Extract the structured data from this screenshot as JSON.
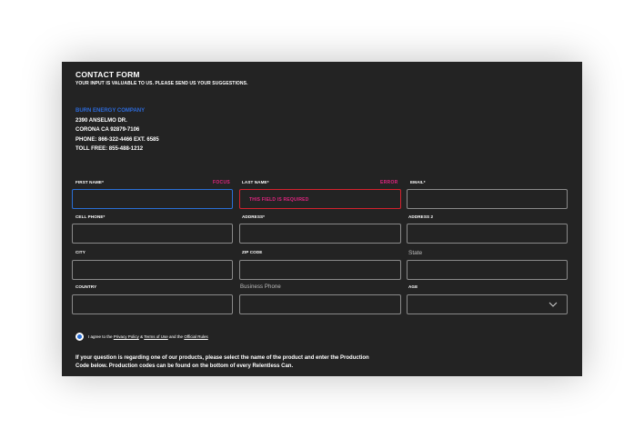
{
  "header": {
    "title": "CONTACT FORM",
    "subtitle": "YOUR INPUT IS VALUABLE TO US. PLEASE SEND US YOUR SUGGESTIONS."
  },
  "company": {
    "name": "BURN ENERGY COMPANY",
    "address1": "2390 ANSELMO DR.",
    "address2": "CORONA CA 92879-7106",
    "phone": "PHONE: 866-322-4466 EXT. 6585",
    "tollfree": "TOLL FREE: 855-488-1212"
  },
  "form": {
    "first_name": {
      "label": "FIRST NAME*",
      "state_tag": "FOCUS"
    },
    "last_name": {
      "label": "LAST NAME*",
      "state_tag": "ERROR",
      "error_message": "THIS FIELD IS REQUIRED"
    },
    "email": {
      "label": "EMAIL*"
    },
    "cell_phone": {
      "label": "CELL PHONE*"
    },
    "address": {
      "label": "ADDRESS*"
    },
    "address2": {
      "label": "ADDRESS 2"
    },
    "city": {
      "label": "CITY"
    },
    "zip": {
      "label": "ZIP CODE"
    },
    "state": {
      "label": "State"
    },
    "country": {
      "label": "COUNTRY"
    },
    "business_phone": {
      "label": "Business Phone"
    },
    "age": {
      "label": "AGE"
    }
  },
  "agreement": {
    "prefix": "I agree to the",
    "privacy": "Privacy Policy",
    "amp": "&",
    "terms": "Terms of Use",
    "and_the": "and the",
    "rules": "Official Rules"
  },
  "note": "If your question is regarding one of our products, please select the name of the product and enter the Production Code below. Production codes can be found on the bottom of every Relentless Can.",
  "colors": {
    "panel_bg": "#232323",
    "accent_blue": "#2a6fd6",
    "error_red": "#d4222e",
    "tag_pink": "#e0247f"
  }
}
